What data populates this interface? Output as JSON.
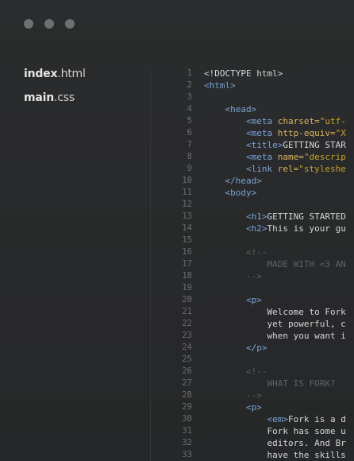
{
  "window": {
    "controls": [
      "close",
      "minimize",
      "maximize"
    ]
  },
  "sidebar": {
    "files": [
      {
        "name": "index",
        "ext": ".html"
      },
      {
        "name": "main",
        "ext": ".css"
      }
    ]
  },
  "editor": {
    "lines": [
      {
        "n": "1",
        "segments": [
          {
            "t": "<!DOCTYPE html>",
            "c": "txt"
          }
        ]
      },
      {
        "n": "2",
        "segments": [
          {
            "t": "<html>",
            "c": "tag"
          }
        ]
      },
      {
        "n": "3",
        "segments": []
      },
      {
        "n": "4",
        "segments": [
          {
            "t": "    ",
            "c": "txt"
          },
          {
            "t": "<head>",
            "c": "tag"
          }
        ]
      },
      {
        "n": "5",
        "segments": [
          {
            "t": "        ",
            "c": "txt"
          },
          {
            "t": "<meta",
            "c": "tag"
          },
          {
            "t": " charset=",
            "c": "attr"
          },
          {
            "t": "\"utf-",
            "c": "str"
          }
        ]
      },
      {
        "n": "6",
        "segments": [
          {
            "t": "        ",
            "c": "txt"
          },
          {
            "t": "<meta",
            "c": "tag"
          },
          {
            "t": " http-equiv=",
            "c": "attr"
          },
          {
            "t": "\"X",
            "c": "str"
          }
        ]
      },
      {
        "n": "7",
        "segments": [
          {
            "t": "        ",
            "c": "txt"
          },
          {
            "t": "<title>",
            "c": "tag"
          },
          {
            "t": "GETTING STAR",
            "c": "txt"
          }
        ]
      },
      {
        "n": "8",
        "segments": [
          {
            "t": "        ",
            "c": "txt"
          },
          {
            "t": "<meta",
            "c": "tag"
          },
          {
            "t": " name=",
            "c": "attr"
          },
          {
            "t": "\"descrip",
            "c": "str"
          }
        ]
      },
      {
        "n": "9",
        "segments": [
          {
            "t": "        ",
            "c": "txt"
          },
          {
            "t": "<link",
            "c": "tag"
          },
          {
            "t": " rel=",
            "c": "attr"
          },
          {
            "t": "\"styleshe",
            "c": "str"
          }
        ]
      },
      {
        "n": "10",
        "segments": [
          {
            "t": "    ",
            "c": "txt"
          },
          {
            "t": "</head>",
            "c": "tag"
          }
        ]
      },
      {
        "n": "11",
        "segments": [
          {
            "t": "    ",
            "c": "txt"
          },
          {
            "t": "<body>",
            "c": "tag"
          }
        ]
      },
      {
        "n": "12",
        "segments": []
      },
      {
        "n": "13",
        "segments": [
          {
            "t": "        ",
            "c": "txt"
          },
          {
            "t": "<h1>",
            "c": "tag"
          },
          {
            "t": "GETTING STARTED",
            "c": "txt"
          }
        ]
      },
      {
        "n": "14",
        "segments": [
          {
            "t": "        ",
            "c": "txt"
          },
          {
            "t": "<h2>",
            "c": "tag"
          },
          {
            "t": "This is your gu",
            "c": "txt"
          }
        ]
      },
      {
        "n": "15",
        "segments": []
      },
      {
        "n": "16",
        "segments": [
          {
            "t": "        <!--",
            "c": "cmt"
          }
        ]
      },
      {
        "n": "17",
        "segments": [
          {
            "t": "            MADE WITH <3 AN",
            "c": "cmt"
          }
        ]
      },
      {
        "n": "18",
        "segments": [
          {
            "t": "        -->",
            "c": "cmt"
          }
        ]
      },
      {
        "n": "19",
        "segments": []
      },
      {
        "n": "20",
        "segments": [
          {
            "t": "        ",
            "c": "txt"
          },
          {
            "t": "<p>",
            "c": "tag"
          }
        ]
      },
      {
        "n": "21",
        "segments": [
          {
            "t": "            Welcome to Fork",
            "c": "txt"
          }
        ]
      },
      {
        "n": "22",
        "segments": [
          {
            "t": "            yet powerful, c",
            "c": "txt"
          }
        ]
      },
      {
        "n": "23",
        "segments": [
          {
            "t": "            when you want i",
            "c": "txt"
          }
        ]
      },
      {
        "n": "24",
        "segments": [
          {
            "t": "        ",
            "c": "txt"
          },
          {
            "t": "</p>",
            "c": "tag"
          }
        ]
      },
      {
        "n": "25",
        "segments": []
      },
      {
        "n": "26",
        "segments": [
          {
            "t": "        <!--",
            "c": "cmt"
          }
        ]
      },
      {
        "n": "27",
        "segments": [
          {
            "t": "            WHAT IS FORK?",
            "c": "cmt"
          }
        ]
      },
      {
        "n": "28",
        "segments": [
          {
            "t": "        -->",
            "c": "cmt"
          }
        ]
      },
      {
        "n": "29",
        "segments": [
          {
            "t": "        ",
            "c": "txt"
          },
          {
            "t": "<p>",
            "c": "tag"
          }
        ]
      },
      {
        "n": "30",
        "segments": [
          {
            "t": "            ",
            "c": "txt"
          },
          {
            "t": "<em>",
            "c": "tag"
          },
          {
            "t": "Fork is a d",
            "c": "txt"
          }
        ]
      },
      {
        "n": "31",
        "segments": [
          {
            "t": "            Fork has some u",
            "c": "txt"
          }
        ]
      },
      {
        "n": "32",
        "segments": [
          {
            "t": "            editors. And Br",
            "c": "txt"
          }
        ]
      },
      {
        "n": "33",
        "segments": [
          {
            "t": "            have the skills",
            "c": "txt"
          }
        ]
      }
    ]
  }
}
